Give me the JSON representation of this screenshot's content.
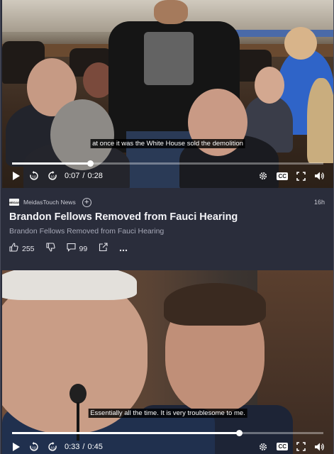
{
  "videos": [
    {
      "caption": "at once it was the White House sold the demolition",
      "current_time": "0:07",
      "time_separator": "/",
      "duration": "0:28",
      "progress": 0.25
    },
    {
      "caption": "Essentially all the time. It is very troublesome to me.",
      "current_time": "0:33",
      "time_separator": "/",
      "duration": "0:45",
      "progress": 0.73
    }
  ],
  "post": {
    "source_logo_text": "MEIDAS",
    "source_name": "MeidasTouch News",
    "add_symbol": "+",
    "age": "16h",
    "title": "Brandon Fellows Removed from Fauci Hearing",
    "subtitle": "Brandon Fellows Removed from Fauci Hearing",
    "likes": "255",
    "comments": "99"
  },
  "icons": {
    "play": "play-icon",
    "rewind": "rewind-10-icon",
    "forward": "forward-10-icon",
    "settings": "gear-icon",
    "cc": "CC",
    "fullscreen": "fullscreen-icon",
    "volume": "volume-icon",
    "like": "thumbs-up-icon",
    "dislike": "thumbs-down-icon",
    "comment": "comment-icon",
    "share": "share-icon",
    "more": "more-icon"
  }
}
